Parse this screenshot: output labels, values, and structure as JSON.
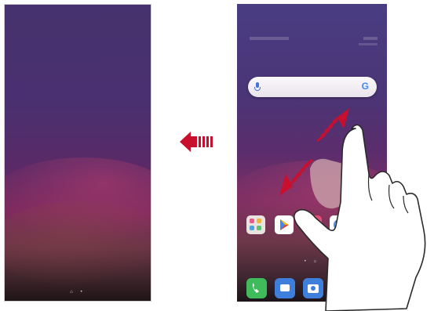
{
  "left_screen": {
    "nav_dots": "⌂ •"
  },
  "right_screen": {
    "nav_dots": "• ⌂",
    "search": {
      "logo": "G"
    },
    "apps": [
      {
        "icon": "app-folder-icon",
        "color": "#e8e3de"
      },
      {
        "icon": "play-store-icon",
        "color": "#ffffff"
      },
      {
        "icon": "photos-icon",
        "color": "#e64d7a"
      },
      {
        "icon": "browser-icon",
        "color": "#ffffff"
      }
    ],
    "dock": [
      {
        "icon": "phone-icon",
        "color": "#3fbb5b"
      },
      {
        "icon": "messages-icon",
        "color": "#3f7fdc"
      },
      {
        "icon": "camera-icon",
        "color": "#3f7fdc"
      },
      {
        "icon": "gallery-icon",
        "color": "#7a55c8"
      }
    ]
  },
  "swipe_arrow_color": "#c8102e",
  "gesture_arrow_color": "#c8102e"
}
